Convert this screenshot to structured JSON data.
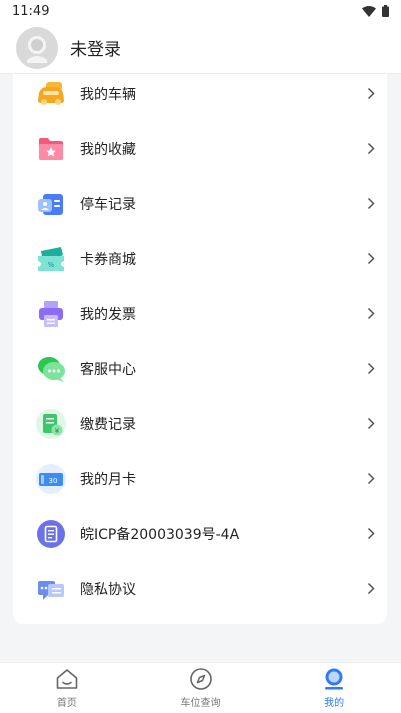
{
  "status_bar": {
    "time": "11:49",
    "icons": [
      "wifi-icon",
      "battery-icon"
    ]
  },
  "header": {
    "title": "未登录",
    "avatar_icon": "default-avatar-icon"
  },
  "menu": {
    "items": [
      {
        "label": "我的车辆",
        "icon": "car-icon",
        "color": "#f5a623"
      },
      {
        "label": "我的收藏",
        "icon": "favorite-folder-icon",
        "color": "#f05a7e"
      },
      {
        "label": "停车记录",
        "icon": "parking-record-icon",
        "color": "#4a7cf7"
      },
      {
        "label": "卡券商城",
        "icon": "coupon-ticket-icon",
        "color": "#23c4b0"
      },
      {
        "label": "我的发票",
        "icon": "invoice-printer-icon",
        "color": "#8a6cf5"
      },
      {
        "label": "客服中心",
        "icon": "chat-bubble-icon",
        "color": "#2dc651"
      },
      {
        "label": "缴费记录",
        "icon": "payment-record-icon",
        "color": "#3ac86a"
      },
      {
        "label": "我的月卡",
        "icon": "monthly-card-icon",
        "color": "#3b8cf5"
      },
      {
        "label": "皖ICP备20003039号-4A",
        "icon": "icp-document-icon",
        "color": "#6b72e8"
      },
      {
        "label": "隐私协议",
        "icon": "privacy-agreement-icon",
        "color": "#6b8cf0"
      }
    ]
  },
  "bottom_nav": {
    "items": [
      {
        "label": "首页",
        "icon": "home-icon"
      },
      {
        "label": "车位查询",
        "icon": "compass-icon"
      },
      {
        "label": "我的",
        "icon": "profile-icon",
        "active": true
      }
    ],
    "active_color": "#2f7bf5"
  }
}
